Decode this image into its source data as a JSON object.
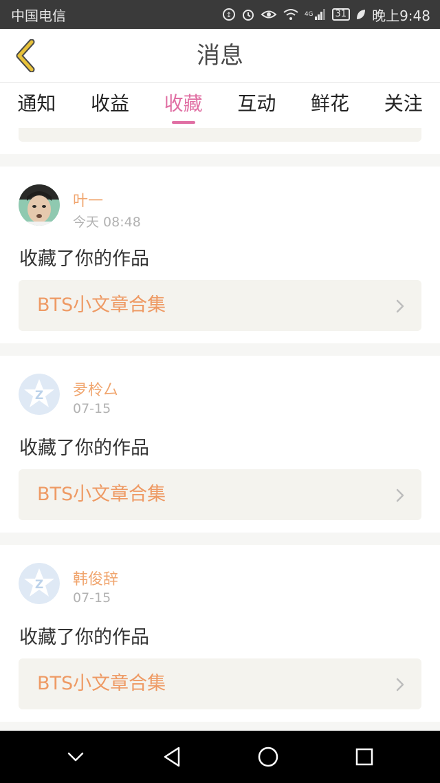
{
  "status_bar": {
    "carrier": "中国电信",
    "network": "4G",
    "battery": "31",
    "time": "晚上9:48"
  },
  "header": {
    "title": "消息",
    "back_icon": "chevron-left-icon"
  },
  "tabs": [
    {
      "label": "通知",
      "active": false
    },
    {
      "label": "收益",
      "active": false
    },
    {
      "label": "收藏",
      "active": true
    },
    {
      "label": "互动",
      "active": false
    },
    {
      "label": "鲜花",
      "active": false
    },
    {
      "label": "关注",
      "active": false
    }
  ],
  "messages": [
    {
      "user": "叶一",
      "time": "今天 08:48",
      "action": "收藏了你的作品",
      "work": "BTS小文章合集",
      "avatar": "photo"
    },
    {
      "user": "夛柃厶",
      "time": "07-15",
      "action": "收藏了你的作品",
      "work": "BTS小文章合集",
      "avatar": "default-qzone-avatar"
    },
    {
      "user": "韩俊辞",
      "time": "07-15",
      "action": "收藏了你的作品",
      "work": "BTS小文章合集",
      "avatar": "default-qzone-avatar"
    }
  ],
  "colors": {
    "accent_pink": "#e06fa3",
    "user_name": "#f0a56e",
    "work_title": "#ee9a64",
    "back_arrow": "#e8c23a"
  }
}
